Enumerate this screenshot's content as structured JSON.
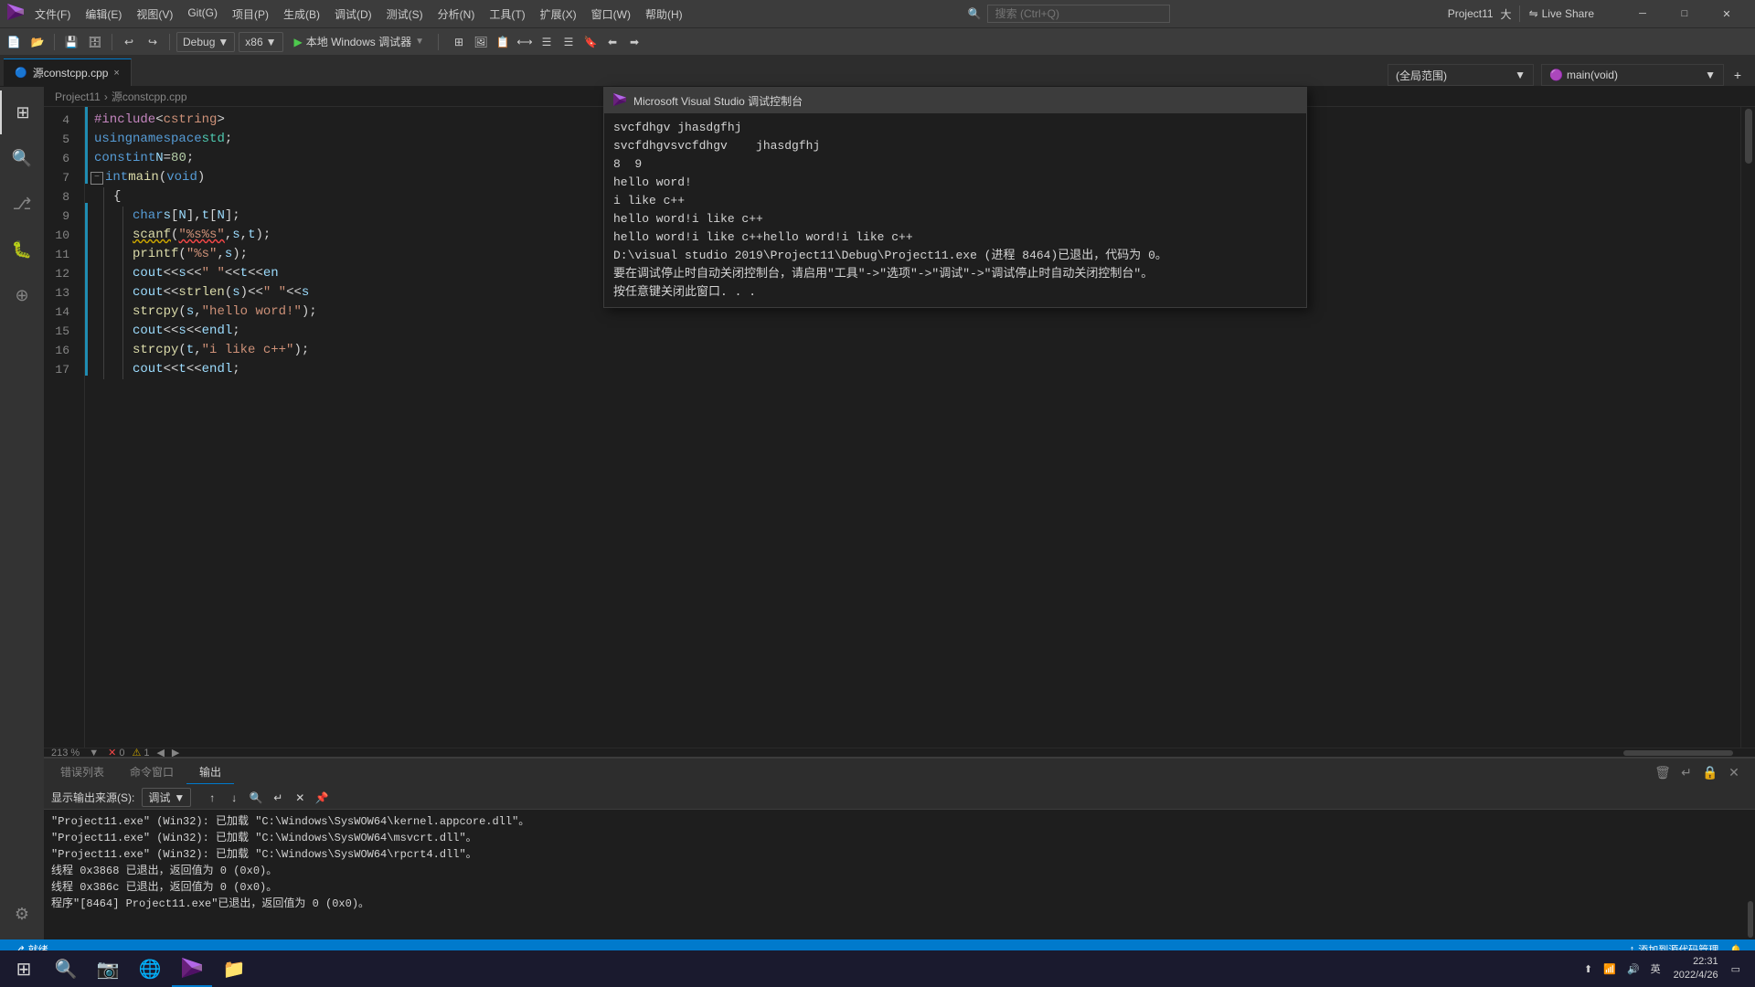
{
  "titleBar": {
    "appIcon": "🔵",
    "menuItems": [
      "文件(F)",
      "编辑(E)",
      "视图(V)",
      "Git(G)",
      "项目(P)",
      "生成(B)",
      "调试(D)",
      "测试(S)",
      "分析(N)",
      "工具(T)",
      "扩展(X)",
      "窗口(W)",
      "帮助(H)"
    ],
    "searchPlaceholder": "搜索 (Ctrl+Q)",
    "projectName": "Project11",
    "liveShareLabel": "Live Share",
    "windowBtnMin": "🗕",
    "windowBtnMax": "🗗",
    "windowBtnClose": "✕",
    "sizeIndicator": "大"
  },
  "toolbar": {
    "debugMode": "Debug",
    "platform": "x86",
    "runLabel": "▶ 本地 Windows 调试器",
    "undoIcon": "↩",
    "redoIcon": "↪"
  },
  "tabs": {
    "activeTab": "源constcpp.cpp",
    "closeIcon": "×",
    "scopeLabel": "(全局范围)",
    "functionLabel": "main(void)"
  },
  "breadcrumb": {
    "project": "Project11",
    "file": "源constcpp.cpp"
  },
  "codeLines": [
    {
      "num": 4,
      "content": "    #include<cstring>",
      "type": "preprocessor"
    },
    {
      "num": 5,
      "content": "    using namespace std;",
      "type": "code"
    },
    {
      "num": 6,
      "content": "    const int N = 80;",
      "type": "code"
    },
    {
      "num": 7,
      "content": "int main(void)",
      "type": "code",
      "foldable": true
    },
    {
      "num": 8,
      "content": "    {",
      "type": "code"
    },
    {
      "num": 9,
      "content": "        char s[N], t[N];",
      "type": "code"
    },
    {
      "num": 10,
      "content": "        scanf(\"%s%s\", s, t);",
      "type": "code",
      "squiggly": true
    },
    {
      "num": 11,
      "content": "        printf(\"%s\", s);",
      "type": "code"
    },
    {
      "num": 12,
      "content": "        cout << s << \"  \" << t << en",
      "type": "code"
    },
    {
      "num": 13,
      "content": "        cout << strlen(s) << \" \" << s",
      "type": "code"
    },
    {
      "num": 14,
      "content": "        strcpy(s, \"hello word!\");",
      "type": "code"
    },
    {
      "num": 15,
      "content": "        cout << s << endl;",
      "type": "code"
    },
    {
      "num": 16,
      "content": "        strcpy(t, \"i like c++\");",
      "type": "code"
    },
    {
      "num": 17,
      "content": "        cout << t << endl;",
      "type": "code"
    }
  ],
  "zoomLevel": "213 %",
  "errorCount": "0",
  "warningCount": "1",
  "bottomPanel": {
    "tabs": [
      "错误列表",
      "命令窗口",
      "输出"
    ],
    "activeTab": "输出",
    "sourceLabel": "显示输出来源(S):",
    "sourceValue": "调试",
    "outputLines": [
      "\"Project11.exe\" (Win32): 已加载 \"C:\\Windows\\SysWOW64\\kernel.appcore.dll\"。",
      "\"Project11.exe\" (Win32): 已加载 \"C:\\Windows\\SysWOW64\\msvcrt.dll\"。",
      "\"Project11.exe\" (Win32): 已加载 \"C:\\Windows\\SysWOW64\\rpcrt4.dll\"。",
      "线程 0x3868 已退出，返回值为 0 (0x0)。",
      "线程 0x386c 已退出，返回值为 0 (0x0)。",
      "程序\"[8464] Project11.exe\"已退出，返回值为 0 (0x0)。"
    ]
  },
  "debugConsole": {
    "title": "Microsoft Visual Studio 调试控制台",
    "icon": "🔵",
    "lines": [
      "svcfdhgv jhasdgfhj",
      "svcfdhgvsvcfdhgv    jhasdgfhj",
      "8  9",
      "hello word!",
      "i like c++",
      "hello word!i like c++",
      "hello word!i like c++hello word!i like c++",
      "D:\\visual studio 2019\\Project11\\Debug\\Project11.exe (进程 8464)已退出，代码为 0。",
      "要在调试停止时自动关闭控制台，请启用\"工具\"->\"选项\"->\"调试\"->\"调试停止时自动关闭控制台\"。",
      "按任意键关闭此窗口. . ."
    ]
  },
  "statusBar": {
    "gitIcon": "⎇",
    "gitBranch": "就绪",
    "errorIcon": "✕",
    "warningIcon": "⚠",
    "sourceControlLabel": "添加到源代码管理",
    "notifIcon": "🔔"
  },
  "taskbar": {
    "startIcon": "⊞",
    "searchIcon": "🔍",
    "items": [
      "📷",
      "🌐",
      "💻",
      "📁"
    ],
    "clock": "22:31",
    "date": "2022/4/26",
    "inputIndicator": "英"
  }
}
